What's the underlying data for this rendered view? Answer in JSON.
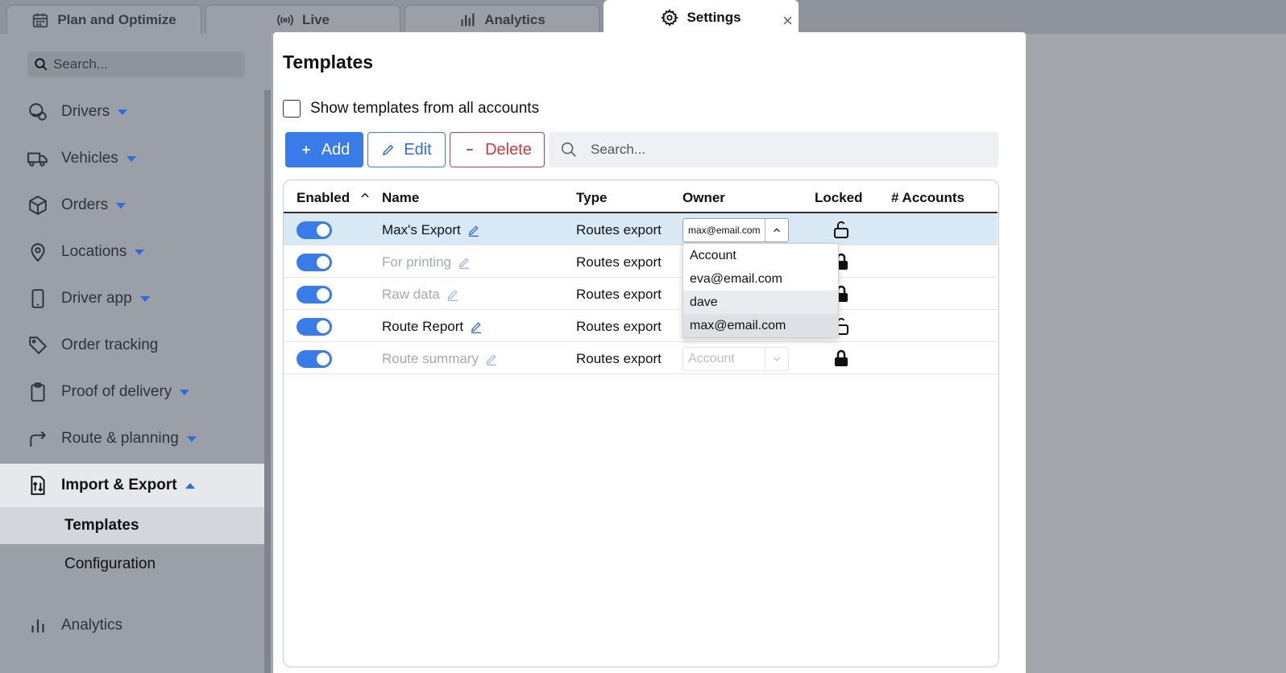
{
  "tabs": [
    {
      "label": "Plan and Optimize",
      "icon": "calendar-icon"
    },
    {
      "label": "Live",
      "icon": "broadcast-icon"
    },
    {
      "label": "Analytics",
      "icon": "bar-chart-icon"
    },
    {
      "label": "Settings",
      "icon": "gear-icon",
      "active": true
    }
  ],
  "sidebar": {
    "search_placeholder": "Search...",
    "items": [
      {
        "label": "Drivers",
        "icon": "driver-icon"
      },
      {
        "label": "Vehicles",
        "icon": "truck-icon"
      },
      {
        "label": "Orders",
        "icon": "box-icon"
      },
      {
        "label": "Locations",
        "icon": "pin-icon"
      },
      {
        "label": "Driver app",
        "icon": "phone-icon"
      },
      {
        "label": "Order tracking",
        "icon": "tag-icon"
      },
      {
        "label": "Proof of delivery",
        "icon": "clipboard-icon"
      },
      {
        "label": "Route & planning",
        "icon": "route-icon"
      },
      {
        "label": "Import & Export",
        "icon": "import-export-icon"
      },
      {
        "label": "Analytics",
        "icon": "bar-chart-icon"
      }
    ],
    "sub_items": [
      "Templates",
      "Configuration"
    ]
  },
  "panel": {
    "title": "Templates",
    "show_all_label": "Show templates from all accounts",
    "add_label": "Add",
    "edit_label": "Edit",
    "delete_label": "Delete",
    "search_placeholder": "Search..."
  },
  "table": {
    "headers": {
      "enabled": "Enabled",
      "name": "Name",
      "type": "Type",
      "owner": "Owner",
      "locked": "Locked",
      "accounts": "# Accounts"
    },
    "rows": [
      {
        "name": "Max's Export",
        "type": "Routes export",
        "owner": "max@email.com",
        "enabled": true,
        "locked": false,
        "dim": false
      },
      {
        "name": "For printing",
        "type": "Routes export",
        "owner": "",
        "enabled": true,
        "locked": true,
        "dim": true
      },
      {
        "name": "Raw data",
        "type": "Routes export",
        "owner": "",
        "enabled": true,
        "locked": true,
        "dim": true
      },
      {
        "name": "Route Report",
        "type": "Routes export",
        "owner": "",
        "enabled": true,
        "locked": false,
        "dim": false
      },
      {
        "name": "Route summary",
        "type": "Routes export",
        "owner": "Account",
        "enabled": true,
        "locked": true,
        "dim": true
      }
    ]
  },
  "owner_dropdown": {
    "options": [
      "Account",
      "eva@email.com",
      "dave",
      "max@email.com"
    ],
    "hovered": "dave",
    "selected": "max@email.com"
  },
  "colors": {
    "accent": "#3a7bea",
    "danger": "#d23a3a",
    "row_highlight": "#d8e8f5"
  }
}
